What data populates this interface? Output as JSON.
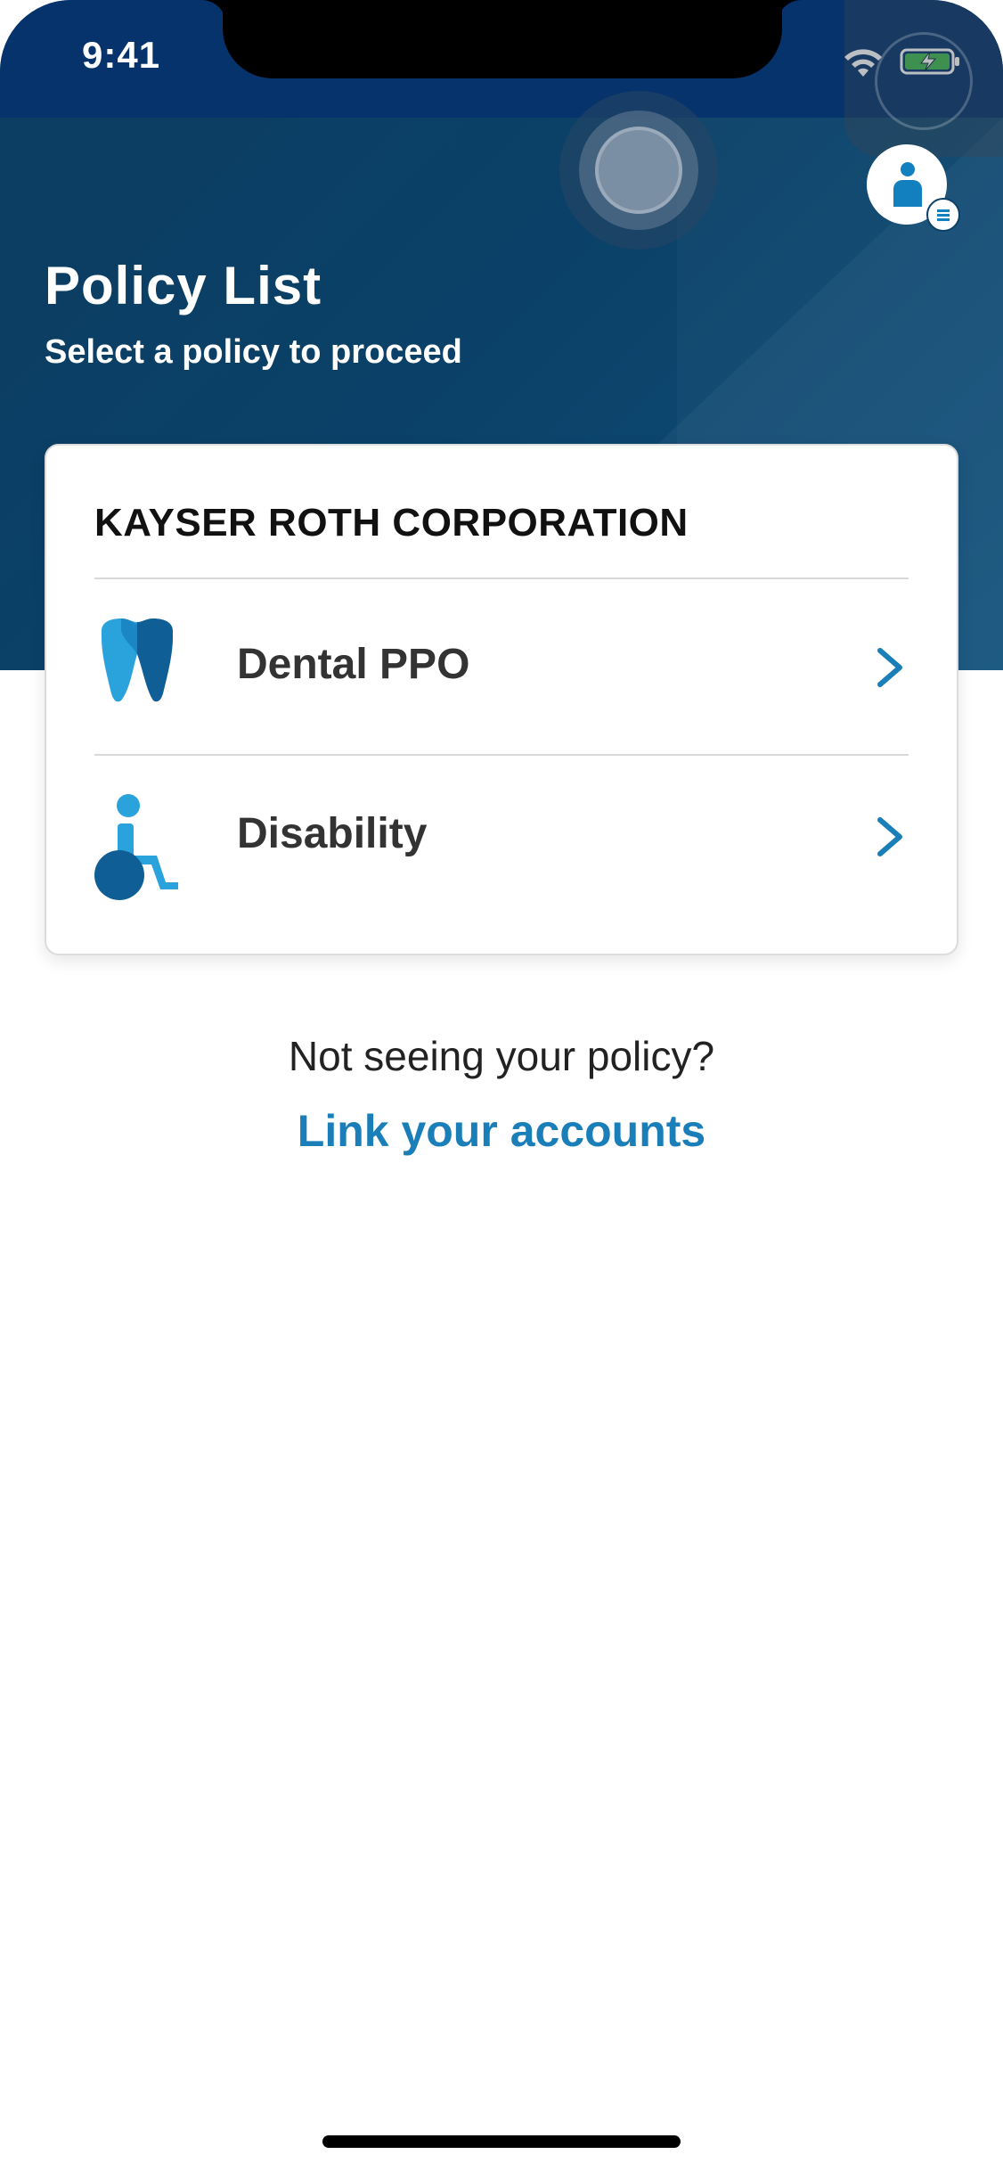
{
  "status_bar": {
    "time": "9:41"
  },
  "header": {
    "title": "Policy List",
    "subtitle": "Select a policy to proceed"
  },
  "card": {
    "company": "KAYSER ROTH CORPORATION",
    "policies": [
      {
        "label": "Dental PPO",
        "icon": "tooth-icon"
      },
      {
        "label": "Disability",
        "icon": "wheelchair-icon"
      }
    ]
  },
  "footer": {
    "prompt": "Not seeing your policy?",
    "link": "Link your accounts"
  },
  "colors": {
    "header_dark": "#06336b",
    "header": "#0b4168",
    "accent": "#1a7fb8",
    "icon_light": "#2aa3dc",
    "icon_dark": "#0f5e96"
  }
}
